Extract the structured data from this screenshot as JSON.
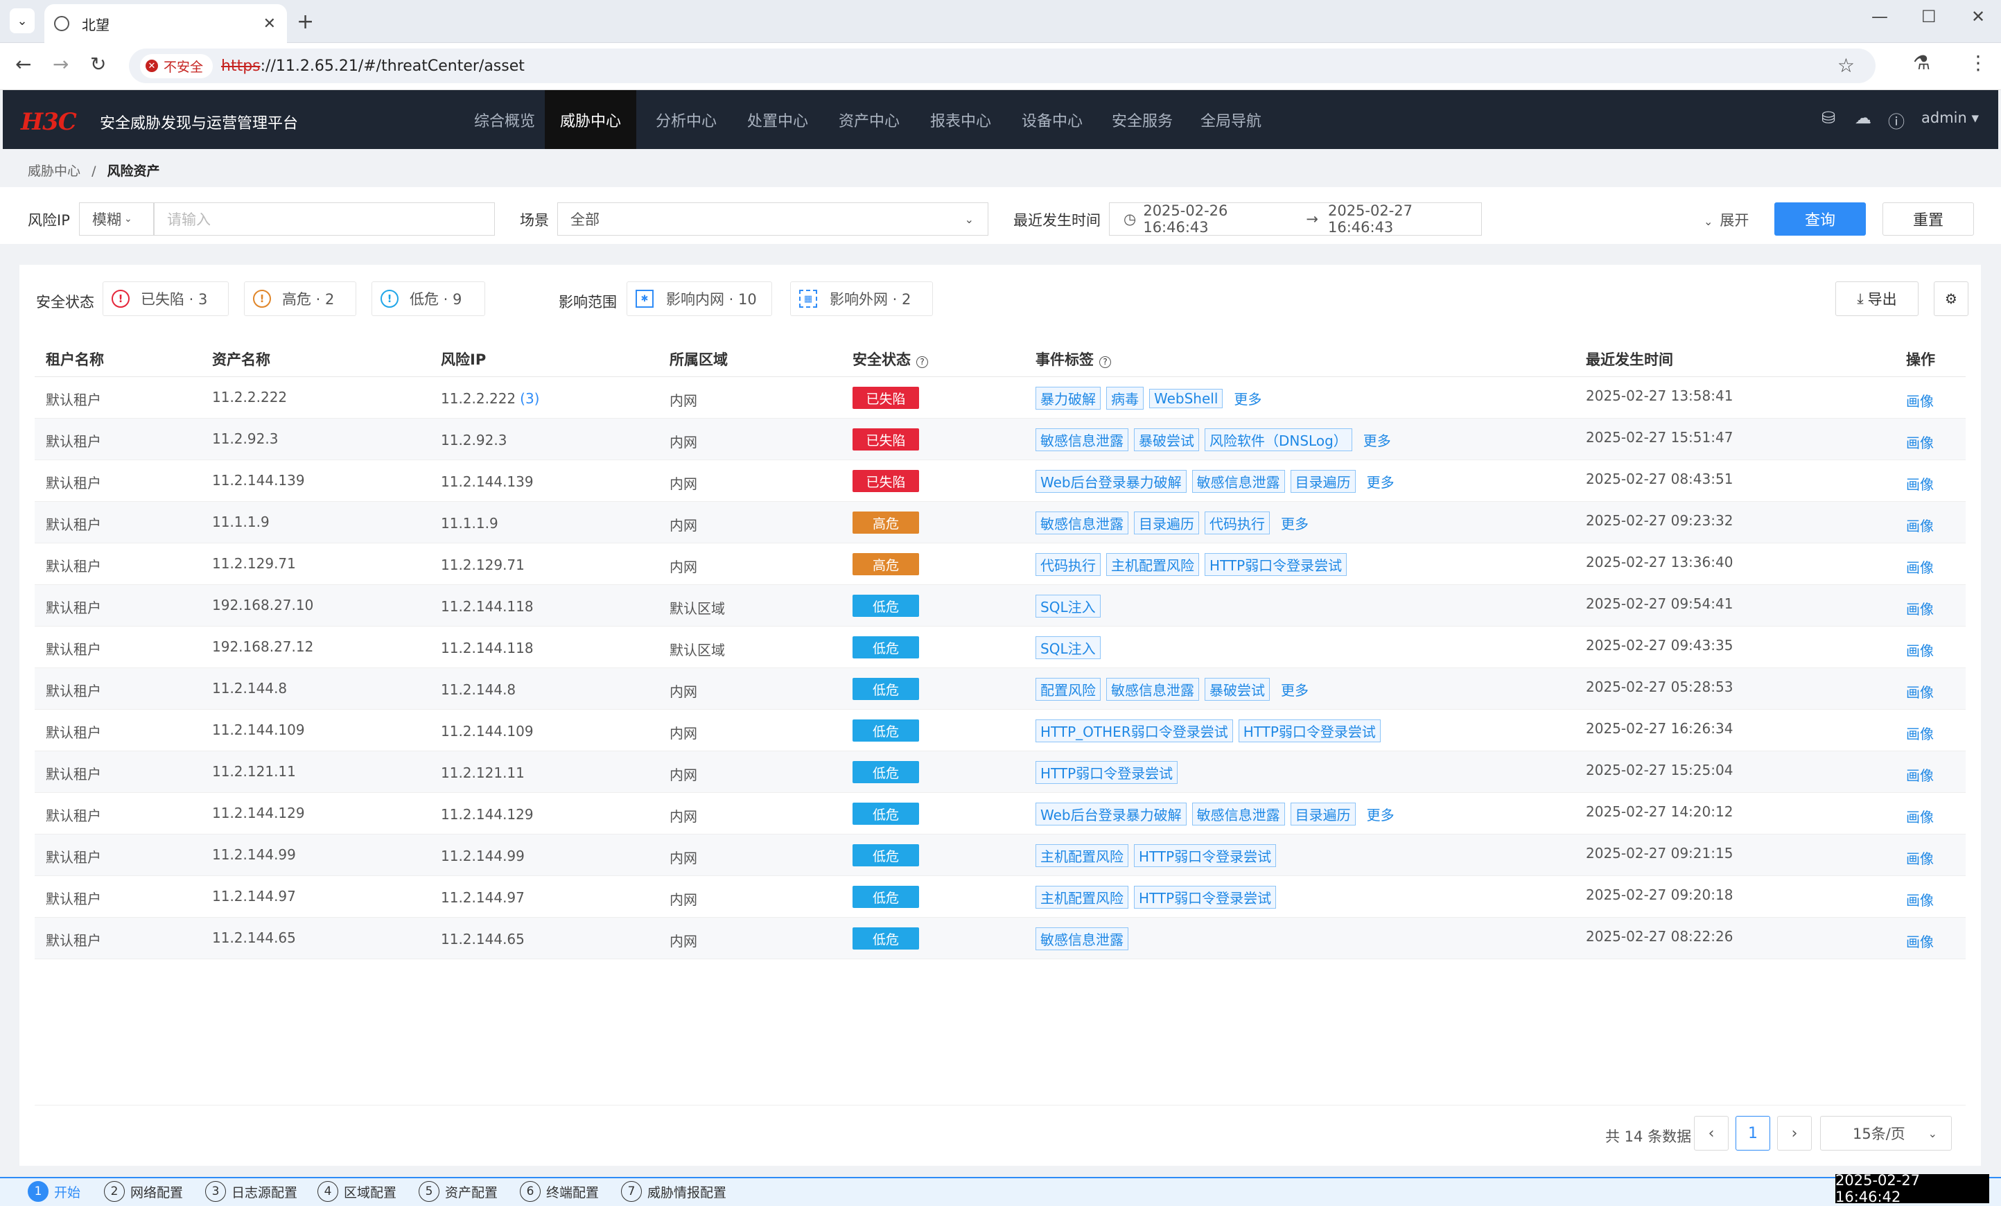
{
  "browser": {
    "tab_title": "北望",
    "insecure_label": "不安全",
    "url_scheme": "https",
    "url_rest": "://11.2.65.21/#/threatCenter/asset"
  },
  "app": {
    "logo": "H3C",
    "title": "安全威胁发现与运营管理平台",
    "menu": [
      "综合概览",
      "威胁中心",
      "分析中心",
      "处置中心",
      "资产中心",
      "报表中心",
      "设备中心",
      "安全服务",
      "全局导航"
    ],
    "active_menu": "威胁中心",
    "user": "admin"
  },
  "breadcrumb": {
    "parent": "威胁中心",
    "separator": "/",
    "current": "风险资产"
  },
  "filters": {
    "ip_label": "风险IP",
    "match_mode": "模糊",
    "ip_placeholder": "请输入",
    "scene_label": "场景",
    "scene_value": "全部",
    "time_label": "最近发生时间",
    "time_start": "2025-02-26 16:46:43",
    "time_end": "2025-02-27 16:46:43",
    "expand_label": "展开",
    "query_label": "查询",
    "reset_label": "重置"
  },
  "stats": {
    "security_label": "安全状态",
    "fallen": "已失陷 · 3",
    "high": "高危 · 2",
    "low": "低危 · 9",
    "scope_label": "影响范围",
    "intranet": "影响内网 · 10",
    "extranet": "影响外网 · 2",
    "export_label": "导出"
  },
  "table": {
    "headers": [
      "租户名称",
      "资产名称",
      "风险IP",
      "所属区域",
      "安全状态",
      "事件标签",
      "最近发生时间",
      "操作"
    ],
    "more_label": "更多",
    "op_label": "画像",
    "rows": [
      {
        "tenant": "默认租户",
        "asset": "11.2.2.222",
        "ip": "11.2.2.222",
        "ipcount": "(3)",
        "zone": "内网",
        "status": "已失陷",
        "level": "fallen",
        "tags": [
          "暴力破解",
          "病毒",
          "WebShell"
        ],
        "more": true,
        "time": "2025-02-27 13:58:41"
      },
      {
        "tenant": "默认租户",
        "asset": "11.2.92.3",
        "ip": "11.2.92.3",
        "ipcount": "",
        "zone": "内网",
        "status": "已失陷",
        "level": "fallen",
        "tags": [
          "敏感信息泄露",
          "暴破尝试",
          "风险软件（DNSLog）"
        ],
        "more": true,
        "time": "2025-02-27 15:51:47"
      },
      {
        "tenant": "默认租户",
        "asset": "11.2.144.139",
        "ip": "11.2.144.139",
        "ipcount": "",
        "zone": "内网",
        "status": "已失陷",
        "level": "fallen",
        "tags": [
          "Web后台登录暴力破解",
          "敏感信息泄露",
          "目录遍历"
        ],
        "more": true,
        "time": "2025-02-27 08:43:51"
      },
      {
        "tenant": "默认租户",
        "asset": "11.1.1.9",
        "ip": "11.1.1.9",
        "ipcount": "",
        "zone": "内网",
        "status": "高危",
        "level": "high",
        "tags": [
          "敏感信息泄露",
          "目录遍历",
          "代码执行"
        ],
        "more": true,
        "time": "2025-02-27 09:23:32"
      },
      {
        "tenant": "默认租户",
        "asset": "11.2.129.71",
        "ip": "11.2.129.71",
        "ipcount": "",
        "zone": "内网",
        "status": "高危",
        "level": "high",
        "tags": [
          "代码执行",
          "主机配置风险",
          "HTTP弱口令登录尝试"
        ],
        "more": false,
        "time": "2025-02-27 13:36:40"
      },
      {
        "tenant": "默认租户",
        "asset": "192.168.27.10",
        "ip": "11.2.144.118",
        "ipcount": "",
        "zone": "默认区域",
        "status": "低危",
        "level": "low",
        "tags": [
          "SQL注入"
        ],
        "more": false,
        "time": "2025-02-27 09:54:41"
      },
      {
        "tenant": "默认租户",
        "asset": "192.168.27.12",
        "ip": "11.2.144.118",
        "ipcount": "",
        "zone": "默认区域",
        "status": "低危",
        "level": "low",
        "tags": [
          "SQL注入"
        ],
        "more": false,
        "time": "2025-02-27 09:43:35"
      },
      {
        "tenant": "默认租户",
        "asset": "11.2.144.8",
        "ip": "11.2.144.8",
        "ipcount": "",
        "zone": "内网",
        "status": "低危",
        "level": "low",
        "tags": [
          "配置风险",
          "敏感信息泄露",
          "暴破尝试"
        ],
        "more": true,
        "time": "2025-02-27 05:28:53"
      },
      {
        "tenant": "默认租户",
        "asset": "11.2.144.109",
        "ip": "11.2.144.109",
        "ipcount": "",
        "zone": "内网",
        "status": "低危",
        "level": "low",
        "tags": [
          "HTTP_OTHER弱口令登录尝试",
          "HTTP弱口令登录尝试"
        ],
        "more": false,
        "time": "2025-02-27 16:26:34"
      },
      {
        "tenant": "默认租户",
        "asset": "11.2.121.11",
        "ip": "11.2.121.11",
        "ipcount": "",
        "zone": "内网",
        "status": "低危",
        "level": "low",
        "tags": [
          "HTTP弱口令登录尝试"
        ],
        "more": false,
        "time": "2025-02-27 15:25:04"
      },
      {
        "tenant": "默认租户",
        "asset": "11.2.144.129",
        "ip": "11.2.144.129",
        "ipcount": "",
        "zone": "内网",
        "status": "低危",
        "level": "low",
        "tags": [
          "Web后台登录暴力破解",
          "敏感信息泄露",
          "目录遍历"
        ],
        "more": true,
        "time": "2025-02-27 14:20:12"
      },
      {
        "tenant": "默认租户",
        "asset": "11.2.144.99",
        "ip": "11.2.144.99",
        "ipcount": "",
        "zone": "内网",
        "status": "低危",
        "level": "low",
        "tags": [
          "主机配置风险",
          "HTTP弱口令登录尝试"
        ],
        "more": false,
        "time": "2025-02-27 09:21:15"
      },
      {
        "tenant": "默认租户",
        "asset": "11.2.144.97",
        "ip": "11.2.144.97",
        "ipcount": "",
        "zone": "内网",
        "status": "低危",
        "level": "low",
        "tags": [
          "主机配置风险",
          "HTTP弱口令登录尝试"
        ],
        "more": false,
        "time": "2025-02-27 09:20:18"
      },
      {
        "tenant": "默认租户",
        "asset": "11.2.144.65",
        "ip": "11.2.144.65",
        "ipcount": "",
        "zone": "内网",
        "status": "低危",
        "level": "low",
        "tags": [
          "敏感信息泄露"
        ],
        "more": false,
        "time": "2025-02-27 08:22:26"
      }
    ]
  },
  "pagination": {
    "total": "共 14 条数据",
    "current": "1",
    "page_size": "15条/页"
  },
  "wizard": {
    "steps": [
      {
        "num": "1",
        "label": "开始"
      },
      {
        "num": "2",
        "label": "网络配置"
      },
      {
        "num": "3",
        "label": "日志源配置"
      },
      {
        "num": "4",
        "label": "区域配置"
      },
      {
        "num": "5",
        "label": "资产配置"
      },
      {
        "num": "6",
        "label": "终端配置"
      },
      {
        "num": "7",
        "label": "威胁情报配置"
      }
    ],
    "active_step": "1"
  },
  "clock": "2025-02-27 16:46:42"
}
